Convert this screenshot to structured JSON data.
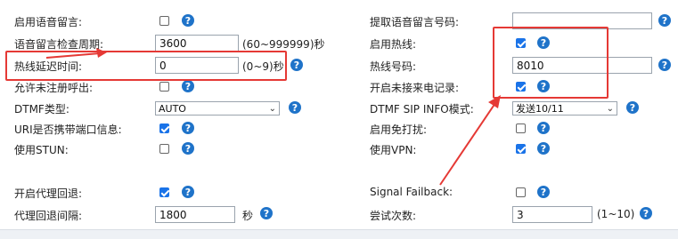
{
  "left": {
    "voicemail_enable": {
      "label": "启用语音留言:",
      "checked": false
    },
    "voicemail_check_period": {
      "label": "语音留言检查周期:",
      "value": "3600",
      "hint": "(60~999999)秒"
    },
    "hotline_delay": {
      "label": "热线延迟时间:",
      "value": "0",
      "hint": "(0~9)秒"
    },
    "allow_unregistered_call": {
      "label": "允许未注册呼出:",
      "checked": false
    },
    "dtmf_type": {
      "label": "DTMF类型:",
      "selected": "AUTO"
    },
    "uri_with_port": {
      "label": "URI是否携带端口信息:",
      "checked": true
    },
    "use_stun": {
      "label": "使用STUN:",
      "checked": false
    },
    "proxy_fallback": {
      "label": "开启代理回退:",
      "checked": true
    },
    "proxy_fallback_interval": {
      "label": "代理回退间隔:",
      "value": "1800",
      "unit": "秒"
    }
  },
  "right": {
    "voicemail_number": {
      "label": "提取语音留言号码:",
      "value": ""
    },
    "hotline_enable": {
      "label": "启用热线:",
      "checked": true
    },
    "hotline_number": {
      "label": "热线号码:",
      "value": "8010"
    },
    "missed_call_log": {
      "label": "开启未接来电记录:",
      "checked": true
    },
    "dtmf_sip_info_mode": {
      "label": "DTMF SIP INFO模式:",
      "selected": "发送10/11"
    },
    "dnd_enable": {
      "label": "启用免打扰:",
      "checked": false
    },
    "use_vpn": {
      "label": "使用VPN:",
      "checked": true
    },
    "signal_failback": {
      "label": "Signal Failback:",
      "checked": false
    },
    "retry_count": {
      "label": "尝试次数:",
      "value": "3",
      "hint": "(1~10)"
    }
  },
  "annotation_color": "#e53935",
  "accent_color": "#1a73e8"
}
